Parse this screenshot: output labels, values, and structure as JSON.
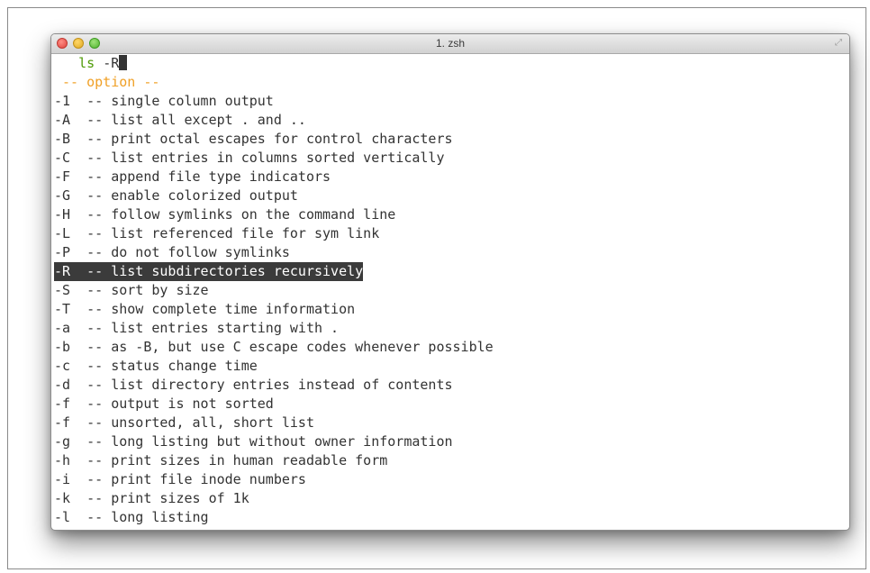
{
  "window": {
    "title": "1. zsh"
  },
  "prompt": {
    "command": "ls",
    "argument": "-R"
  },
  "section_header": "-- option --",
  "options": [
    {
      "flag": "-1",
      "desc": "-- single column output"
    },
    {
      "flag": "-A",
      "desc": "-- list all except . and .."
    },
    {
      "flag": "-B",
      "desc": "-- print octal escapes for control characters"
    },
    {
      "flag": "-C",
      "desc": "-- list entries in columns sorted vertically"
    },
    {
      "flag": "-F",
      "desc": "-- append file type indicators"
    },
    {
      "flag": "-G",
      "desc": "-- enable colorized output"
    },
    {
      "flag": "-H",
      "desc": "-- follow symlinks on the command line"
    },
    {
      "flag": "-L",
      "desc": "-- list referenced file for sym link"
    },
    {
      "flag": "-P",
      "desc": "-- do not follow symlinks"
    },
    {
      "flag": "-R",
      "desc": "-- list subdirectories recursively",
      "selected": true
    },
    {
      "flag": "-S",
      "desc": "-- sort by size"
    },
    {
      "flag": "-T",
      "desc": "-- show complete time information"
    },
    {
      "flag": "-a",
      "desc": "-- list entries starting with ."
    },
    {
      "flag": "-b",
      "desc": "-- as -B, but use C escape codes whenever possible"
    },
    {
      "flag": "-c",
      "desc": "-- status change time"
    },
    {
      "flag": "-d",
      "desc": "-- list directory entries instead of contents"
    },
    {
      "flag": "-f",
      "desc": "-- output is not sorted"
    },
    {
      "flag": "-f",
      "desc": "-- unsorted, all, short list"
    },
    {
      "flag": "-g",
      "desc": "-- long listing but without owner information"
    },
    {
      "flag": "-h",
      "desc": "-- print sizes in human readable form"
    },
    {
      "flag": "-i",
      "desc": "-- print file inode numbers"
    },
    {
      "flag": "-k",
      "desc": "-- print sizes of 1k"
    },
    {
      "flag": "-l",
      "desc": "-- long listing"
    }
  ],
  "colors": {
    "prompt_green": "#4e9a06",
    "header_orange": "#f0a026",
    "selection_bg": "#3b3b3b"
  },
  "icons": [
    "close-icon",
    "minimize-icon",
    "zoom-icon",
    "fullscreen-icon"
  ]
}
